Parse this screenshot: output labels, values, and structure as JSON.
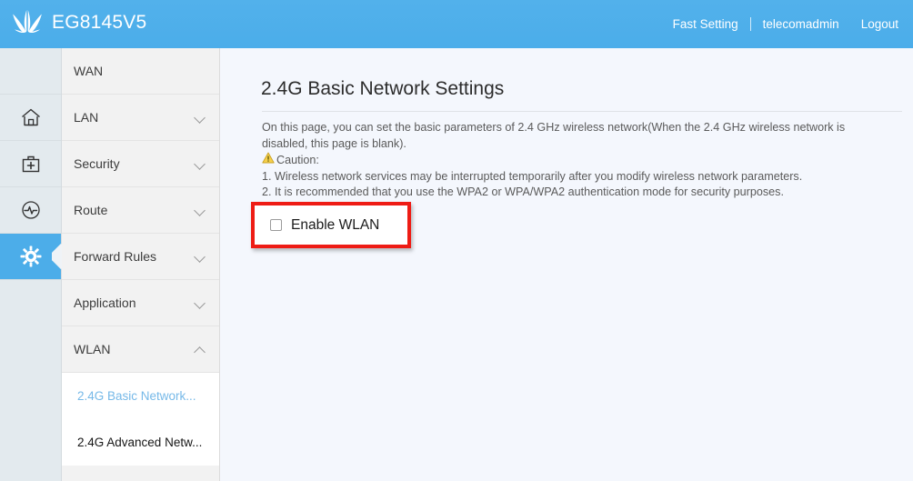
{
  "header": {
    "brand": "EG8145V5",
    "logo_icon": "huawei-flower-logo",
    "fast_setting": "Fast Setting",
    "username": "telecomadmin",
    "logout": "Logout",
    "background_color": "#4cade9"
  },
  "iconbar": {
    "items": [
      {
        "name": "spacer",
        "icon": "",
        "active": false
      },
      {
        "name": "home",
        "icon": "home-icon",
        "active": false
      },
      {
        "name": "toolbox",
        "icon": "toolbox-icon",
        "active": false
      },
      {
        "name": "diagnostics",
        "icon": "diagnostics-icon",
        "active": false
      },
      {
        "name": "settings",
        "icon": "gear-icon",
        "active": true
      },
      {
        "name": "spacer-bottom",
        "icon": "",
        "active": false
      }
    ]
  },
  "menu": {
    "items": [
      {
        "label": "WAN",
        "expandable": false,
        "expanded": false
      },
      {
        "label": "LAN",
        "expandable": true,
        "expanded": false
      },
      {
        "label": "Security",
        "expandable": true,
        "expanded": false
      },
      {
        "label": "Route",
        "expandable": true,
        "expanded": false
      },
      {
        "label": "Forward Rules",
        "expandable": true,
        "expanded": false
      },
      {
        "label": "Application",
        "expandable": true,
        "expanded": false
      },
      {
        "label": "WLAN",
        "expandable": true,
        "expanded": true
      }
    ],
    "submenu": [
      {
        "label": "2.4G Basic Network...",
        "active": true
      },
      {
        "label": "2.4G Advanced Netw...",
        "active": false
      }
    ]
  },
  "content": {
    "title": "2.4G Basic Network Settings",
    "description_line1": "On this page, you can set the basic parameters of 2.4 GHz wireless network(When the 2.4 GHz wireless network is",
    "description_line2": "disabled, this page is blank).",
    "caution_label": "Caution:",
    "caution_icon": "warning-triangle-icon",
    "caution_item1": "1. Wireless network services may be interrupted temporarily after you modify wireless network parameters.",
    "caution_item2": "2. It is recommended that you use the WPA2 or WPA/WPA2 authentication mode for security purposes.",
    "enable_wlan_label": "Enable WLAN",
    "enable_wlan_checked": false,
    "highlight_color": "#ee1c15"
  }
}
